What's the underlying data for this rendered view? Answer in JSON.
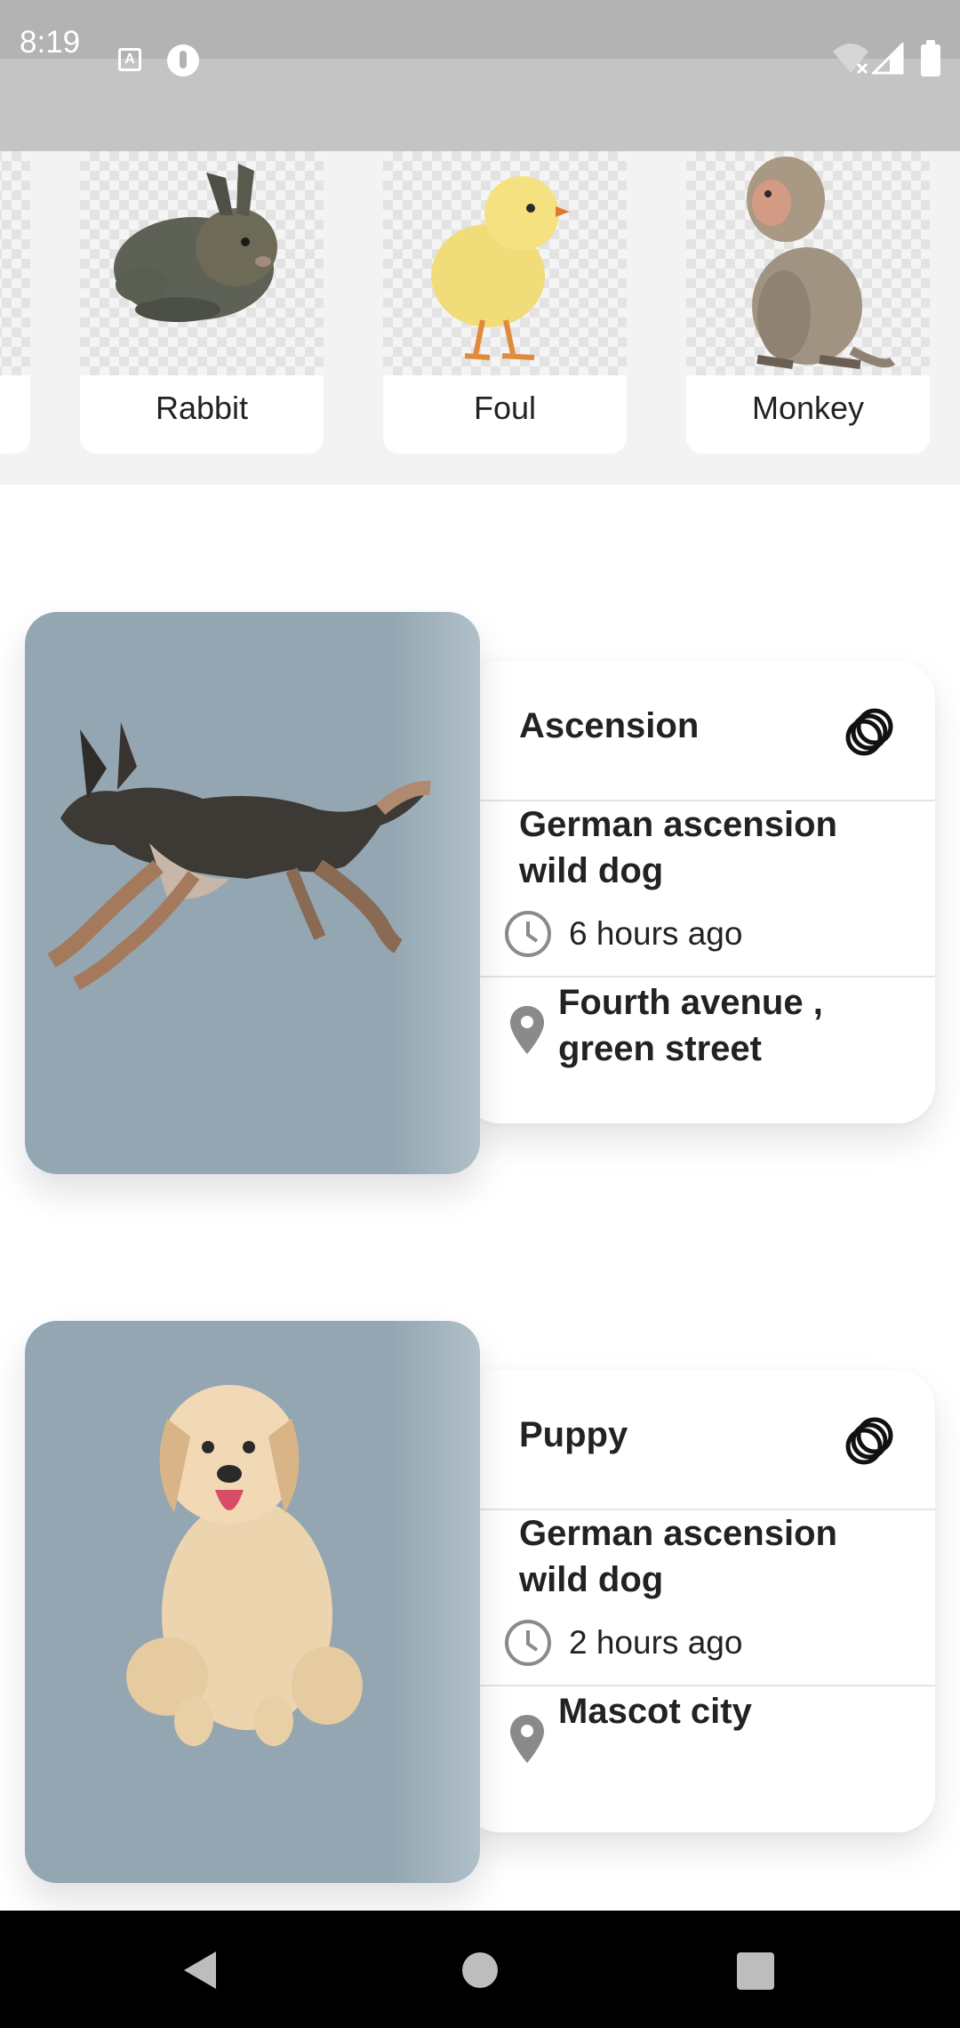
{
  "status_bar": {
    "time": "8:19",
    "icons": [
      "keyboard-a-icon",
      "app-p-icon",
      "wifi-off-icon",
      "signal-icon",
      "battery-icon"
    ]
  },
  "categories": [
    {
      "label": "",
      "icon": "partial-animal-image"
    },
    {
      "label": "Rabbit",
      "icon": "rabbit-image"
    },
    {
      "label": "Foul",
      "icon": "chick-image"
    },
    {
      "label": "Monkey",
      "icon": "monkey-image"
    }
  ],
  "posts": [
    {
      "title": "Ascension",
      "description": "German ascension wild dog",
      "time": "6 hours ago",
      "location": "Fourth avenue , green street",
      "image": "running-dog-image",
      "share_icon": "share-rings-icon"
    },
    {
      "title": "Puppy",
      "description": "German ascension wild dog",
      "time": "2 hours ago",
      "location": "Mascot city",
      "image": "puppy-image",
      "share_icon": "share-rings-icon"
    }
  ],
  "nav_bar": {
    "icons": [
      "back-icon",
      "home-icon",
      "recents-icon"
    ]
  },
  "colors": {
    "status_bar": "#b3b3b3",
    "app_bar": "#c4c4c4",
    "category_strip": "#f3f3f3",
    "image_bg": "#93a6b2",
    "card": "#ffffff",
    "text": "#222222",
    "nav_bar": "#000000"
  }
}
